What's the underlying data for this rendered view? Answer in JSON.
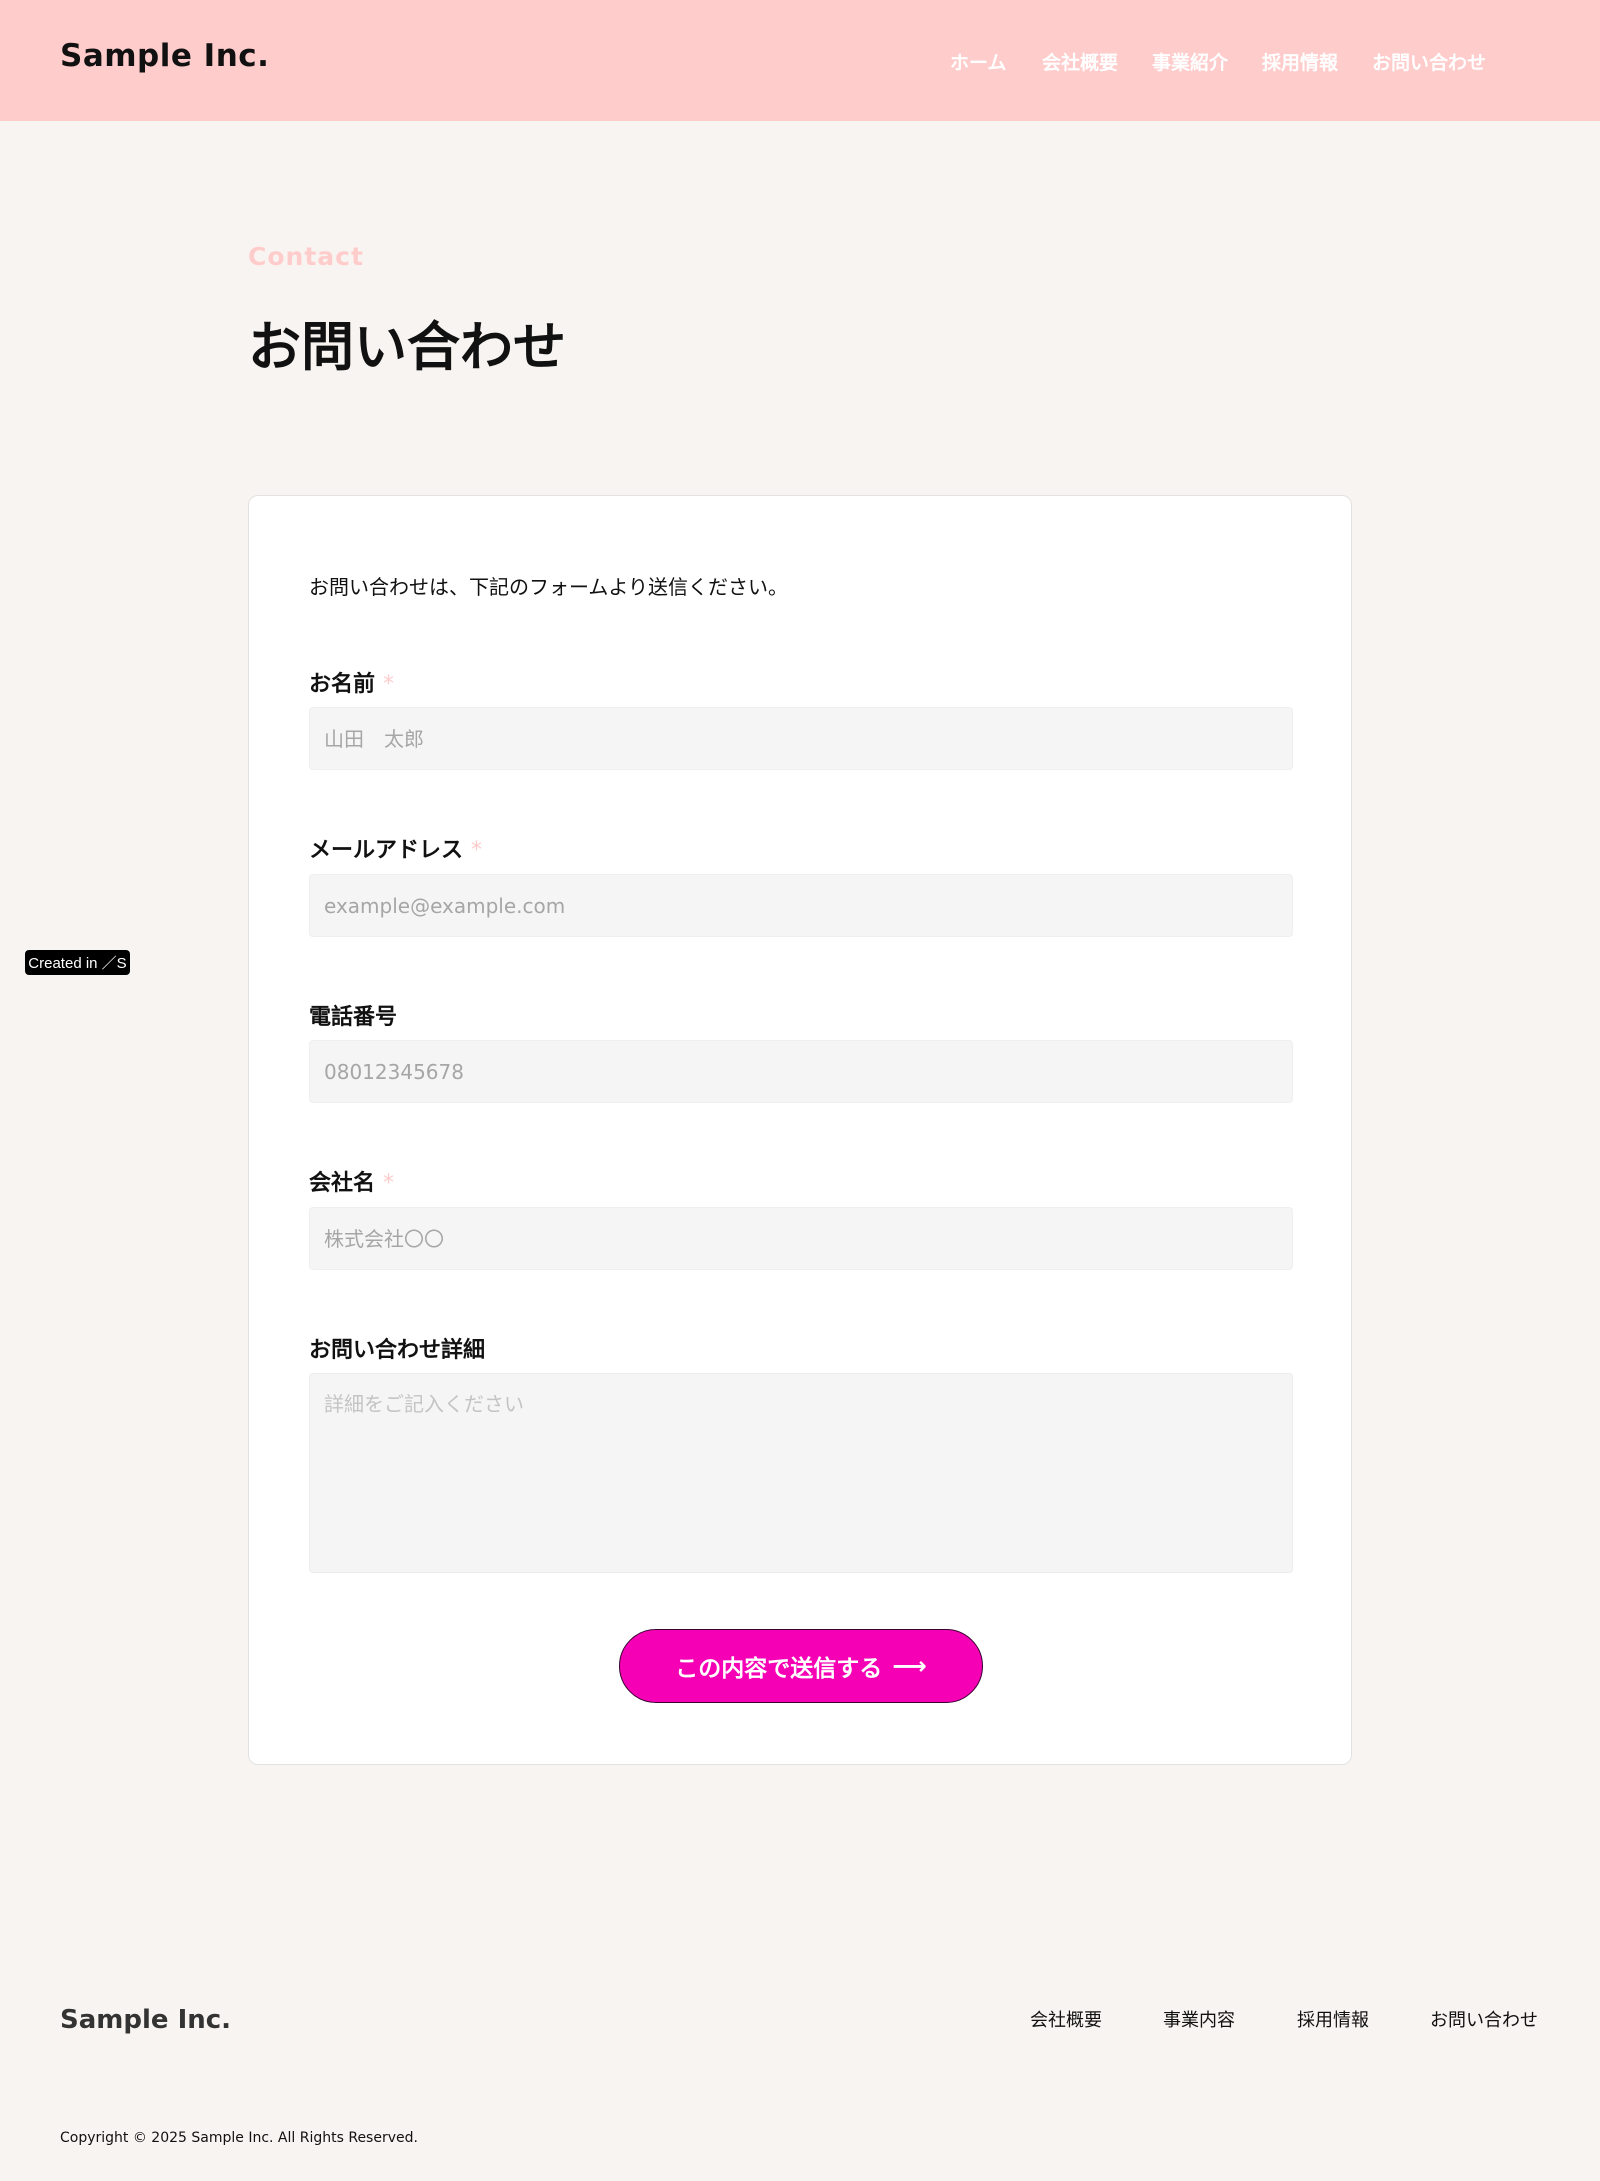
{
  "header": {
    "logo": "Sample Inc.",
    "nav": [
      "ホーム",
      "会社概要",
      "事業紹介",
      "採用情報",
      "お問い合わせ"
    ]
  },
  "page": {
    "eyebrow": "Contact",
    "title": "お問い合わせ"
  },
  "form": {
    "intro": "お問い合わせは、下記のフォームより送信ください。",
    "required_mark": "*",
    "fields": {
      "name": {
        "label": "お名前",
        "placeholder": "山田　太郎",
        "required": true
      },
      "email": {
        "label": "メールアドレス",
        "placeholder": "example@example.com",
        "required": true
      },
      "phone": {
        "label": "電話番号",
        "placeholder": "08012345678",
        "required": false
      },
      "company": {
        "label": "会社名",
        "placeholder": "株式会社〇〇",
        "required": true
      },
      "details": {
        "label": "お問い合わせ詳細",
        "placeholder": "詳細をご記入ください",
        "required": false
      }
    },
    "submit_label": "この内容で送信する",
    "submit_arrow": "⟶"
  },
  "badge": {
    "label": "Created in ／S"
  },
  "footer": {
    "logo": "Sample Inc.",
    "nav": [
      "会社概要",
      "事業内容",
      "採用情報",
      "お問い合わせ"
    ],
    "copyright": "Copyright © 2025 Sample Inc. All Rights Reserved."
  },
  "colors": {
    "header_bg": "#ffcccc",
    "page_bg": "#f8f4f1",
    "accent_button": "#f500b4",
    "required_mark": "#ffcccc"
  }
}
